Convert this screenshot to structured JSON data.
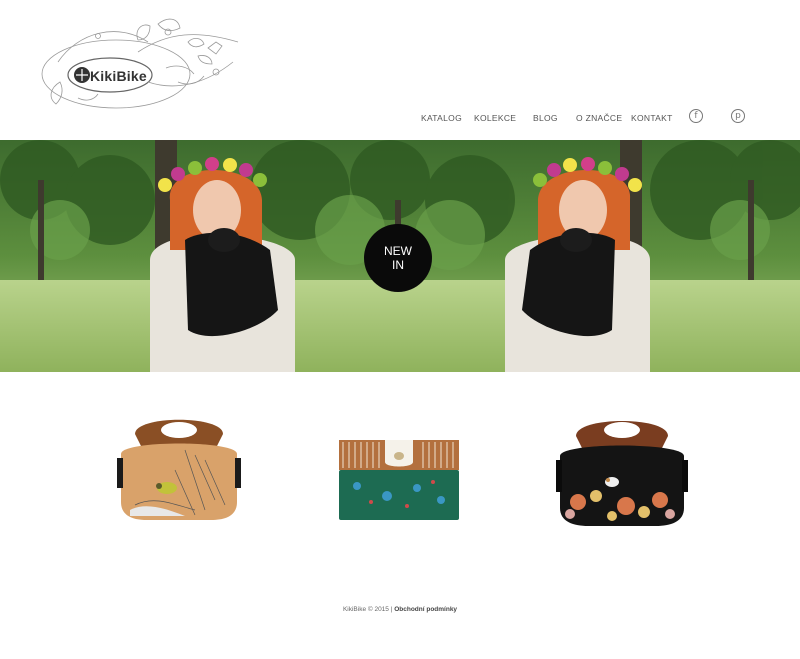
{
  "logo": {
    "text": "KikiBike"
  },
  "nav": [
    {
      "label": "KATALOG"
    },
    {
      "label": "KOLEKCE"
    },
    {
      "label": "BLOG"
    },
    {
      "label": "O ZNAČCE"
    },
    {
      "label": "KONTAKT"
    }
  ],
  "social": {
    "facebook_icon": "facebook-icon",
    "pinterest_icon": "pinterest-icon"
  },
  "hero": {
    "badge_line1": "NEW",
    "badge_line2": "IN"
  },
  "products": [
    {
      "name": "bag-orange-bird",
      "icon": "handbag-icon"
    },
    {
      "name": "clutch-green-floral",
      "icon": "clutch-icon"
    },
    {
      "name": "bag-black-floral",
      "icon": "handbag-icon"
    }
  ],
  "footer": {
    "copyright": "KikiBike © 2015 | ",
    "terms": "Obchodní podmínky"
  }
}
